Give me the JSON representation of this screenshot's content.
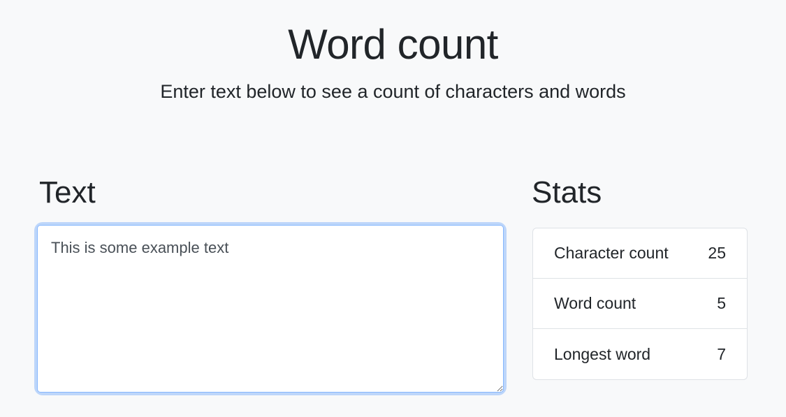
{
  "header": {
    "title": "Word count",
    "lead": "Enter text below to see a count of characters and words"
  },
  "text_section": {
    "heading": "Text",
    "textarea_value": "This is some example text"
  },
  "stats_section": {
    "heading": "Stats",
    "rows": [
      {
        "label": "Character count",
        "value": "25"
      },
      {
        "label": "Word count",
        "value": "5"
      },
      {
        "label": "Longest word",
        "value": "7"
      }
    ]
  }
}
